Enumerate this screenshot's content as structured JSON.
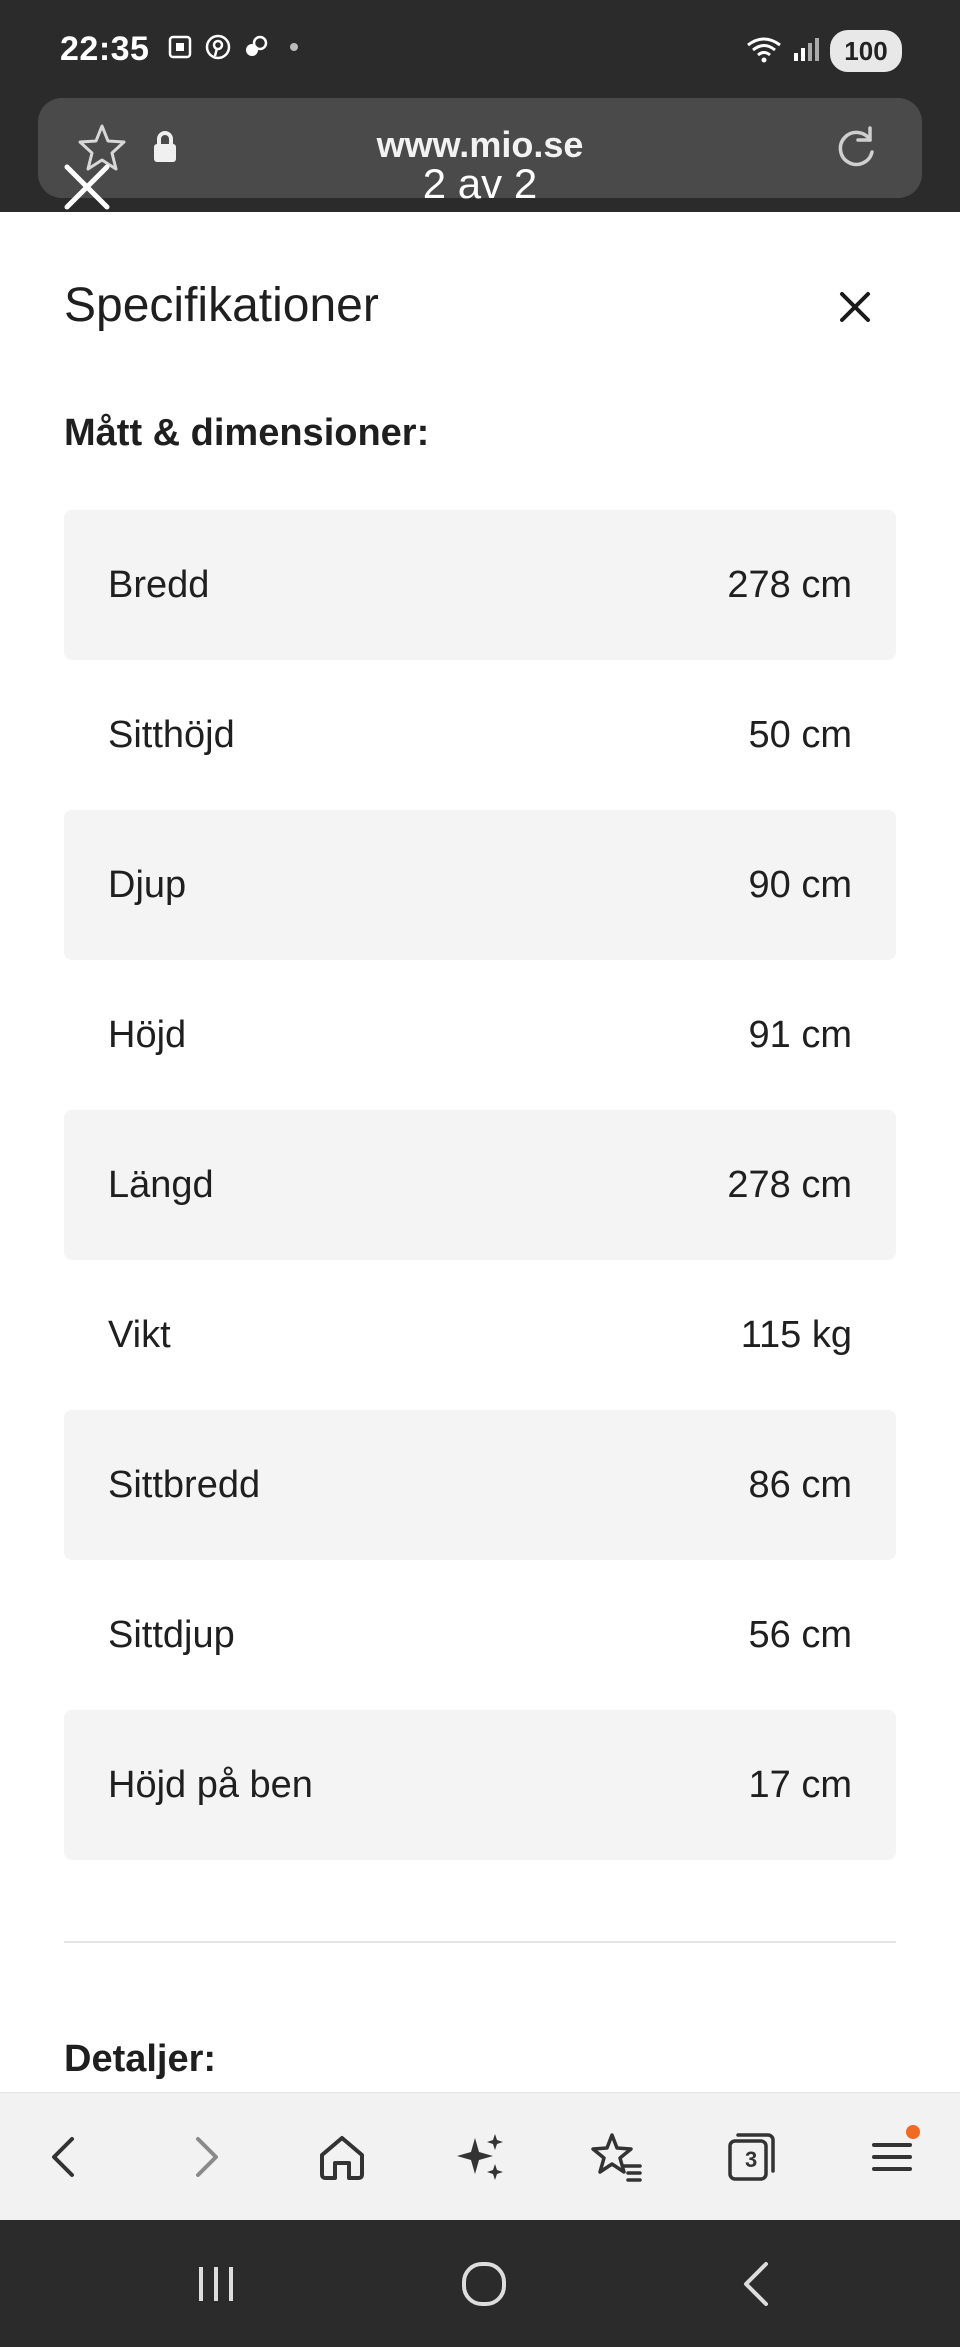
{
  "status_bar": {
    "time": "22:35",
    "battery": "100"
  },
  "browser": {
    "url": "www.mio.se",
    "gallery_counter": "2 av 2"
  },
  "panel": {
    "title": "Specifikationer",
    "section_dimensions": "Mått & dimensioner:",
    "specs": [
      {
        "label": "Bredd",
        "value": "278 cm"
      },
      {
        "label": "Sitthöjd",
        "value": "50 cm"
      },
      {
        "label": "Djup",
        "value": "90 cm"
      },
      {
        "label": "Höjd",
        "value": "91 cm"
      },
      {
        "label": "Längd",
        "value": "278 cm"
      },
      {
        "label": "Vikt",
        "value": "115 kg"
      },
      {
        "label": "Sittbredd",
        "value": "86 cm"
      },
      {
        "label": "Sittdjup",
        "value": "56 cm"
      },
      {
        "label": "Höjd på ben",
        "value": "17 cm"
      }
    ],
    "section_details": "Detaljer:"
  },
  "toolbar": {
    "tabs_count": "3",
    "menu_badge_color": "#f26a21",
    "icons": [
      "back-icon",
      "forward-icon",
      "home-icon",
      "sparkle-icon",
      "bookmarks-icon",
      "tabs-icon",
      "menu-icon"
    ]
  },
  "colors": {
    "status_bg": "#2b2b2b",
    "row_shade": "#f4f4f4",
    "accent": "#f26a21"
  }
}
